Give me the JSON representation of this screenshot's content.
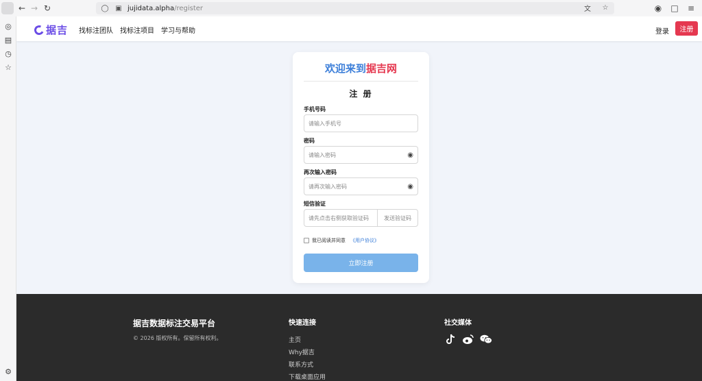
{
  "browser": {
    "url_host": "jujidata.alpha",
    "url_path": "/register"
  },
  "header": {
    "logo_text": "据吉",
    "nav": [
      "找标注团队",
      "找标注项目",
      "学习与帮助"
    ],
    "login_label": "登录",
    "register_label": "注册"
  },
  "card": {
    "welcome_prefix": "欢迎来到",
    "welcome_brand": "据吉网",
    "title": "注 册",
    "phone_label": "手机号码",
    "phone_placeholder": "请输入手机号",
    "password_label": "密码",
    "password_placeholder": "请输入密码",
    "confirm_label": "再次输入密码",
    "confirm_placeholder": "请再次输入密码",
    "sms_label": "短信验证",
    "sms_placeholder": "请先点击右侧获取验证码",
    "sms_button": "发送验证码",
    "agree_text": "我已阅读并同意",
    "agree_link": "《用户协议》",
    "submit_label": "立即注册"
  },
  "footer": {
    "brand_title": "据吉数据标注交易平台",
    "copyright": "© 2026 版权所有。保留所有权利。",
    "quick_links_title": "快速连接",
    "quick_links": [
      "主页",
      "Why据吉",
      "联系方式",
      "下载桌面应用"
    ],
    "social_title": "社交媒体",
    "social_icons": [
      "tiktok-icon",
      "weibo-icon",
      "wechat-icon"
    ]
  },
  "colors": {
    "brand_purple": "#6b4de6",
    "accent_red": "#e53850",
    "accent_blue": "#3d7fd9",
    "button_blue": "#79b3ea",
    "footer_bg": "#2b2b2b"
  }
}
